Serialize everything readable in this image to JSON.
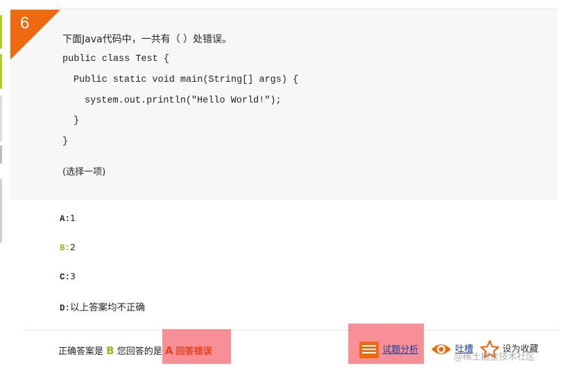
{
  "question": {
    "number": "6",
    "title": "下面Java代码中，一共有（   ）处错误。",
    "code_lines": [
      "public class Test {",
      "Public static void main(String[] args) {",
      "system.out.println(\"Hello World!\");",
      "}",
      "}"
    ],
    "hint": "(选择一项)"
  },
  "options": [
    {
      "letter": "A",
      "sep": ":",
      "text": "1"
    },
    {
      "letter": "B",
      "sep": ":",
      "text": "2"
    },
    {
      "letter": "C",
      "sep": ":",
      "text": "3"
    },
    {
      "letter": "D",
      "sep": ":",
      "text": "以上答案均不正确"
    }
  ],
  "answer": {
    "correct_label": "正确答案是",
    "correct_value": "B",
    "user_label": "您回答的是",
    "user_value": "A",
    "status": "回答错误"
  },
  "actions": {
    "analysis_label": "试题分析",
    "comment_label": "吐槽",
    "favorite_label": "设为收藏"
  },
  "watermark": "@稀土掘金技术社区",
  "colors": {
    "accent_orange": "#ee6a10",
    "correct_green": "#9ab51a",
    "error_red": "#e8411a",
    "highlight": "#f6646e",
    "link_blue": "#1a3e9a"
  }
}
